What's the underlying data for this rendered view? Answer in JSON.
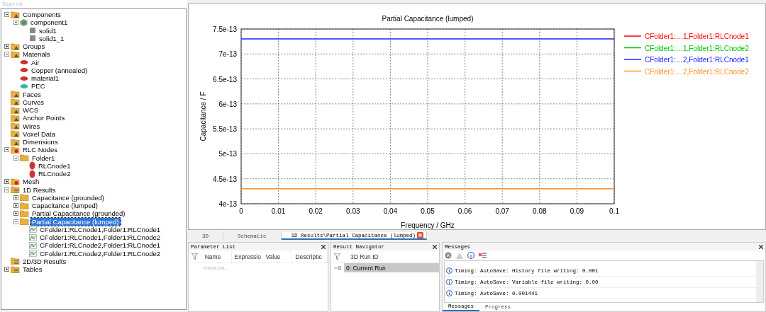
{
  "search": {
    "placeholder": "Search"
  },
  "tree": [
    {
      "label": "Components",
      "kind": "folder",
      "expanded": true,
      "selected": false,
      "children": [
        {
          "label": "component1",
          "kind": "component",
          "expanded": true,
          "selected": false,
          "children": [
            {
              "label": "solid1",
              "kind": "solid",
              "selected": false
            },
            {
              "label": "solid1_1",
              "kind": "solid",
              "selected": false
            }
          ]
        }
      ]
    },
    {
      "label": "Groups",
      "kind": "folder",
      "expanded": false,
      "selected": false
    },
    {
      "label": "Materials",
      "kind": "folder",
      "expanded": true,
      "selected": false,
      "children": [
        {
          "label": "Air",
          "kind": "material",
          "color": "#d03030",
          "selected": false
        },
        {
          "label": "Copper (annealed)",
          "kind": "material",
          "color": "#d03030",
          "selected": false
        },
        {
          "label": "material1",
          "kind": "material",
          "color": "#d03030",
          "selected": false
        },
        {
          "label": "PEC",
          "kind": "material",
          "color": "#30b8b0",
          "selected": false
        }
      ]
    },
    {
      "label": "Faces",
      "kind": "folder",
      "selected": false
    },
    {
      "label": "Curves",
      "kind": "folder",
      "selected": false
    },
    {
      "label": "WCS",
      "kind": "folder",
      "selected": false
    },
    {
      "label": "Anchor Points",
      "kind": "folder",
      "selected": false
    },
    {
      "label": "Wires",
      "kind": "folder",
      "selected": false
    },
    {
      "label": "Voxel Data",
      "kind": "folder",
      "selected": false
    },
    {
      "label": "Dimensions",
      "kind": "folder",
      "selected": false
    },
    {
      "label": "RLC Nodes",
      "kind": "gearfolder",
      "expanded": true,
      "selected": false,
      "children": [
        {
          "label": "Folder1",
          "kind": "plainfolder",
          "expanded": true,
          "selected": false,
          "children": [
            {
              "label": "RLCnode1",
              "kind": "node",
              "selected": false
            },
            {
              "label": "RLCnode2",
              "kind": "node",
              "selected": false
            }
          ]
        }
      ]
    },
    {
      "label": "Mesh",
      "kind": "gearfolder",
      "expanded": false,
      "selected": false
    },
    {
      "label": "1D Results",
      "kind": "resultfolder",
      "expanded": true,
      "selected": false,
      "children": [
        {
          "label": "Capacitance (grounded)",
          "kind": "plainfolder",
          "expanded": false,
          "selected": false
        },
        {
          "label": "Capacitance (lumped)",
          "kind": "plainfolder",
          "expanded": false,
          "selected": false
        },
        {
          "label": "Partial Capacitance (grounded)",
          "kind": "plainfolder",
          "expanded": false,
          "selected": false
        },
        {
          "label": "Partial Capacitance (lumped)",
          "kind": "plainfolder",
          "expanded": true,
          "selected": true,
          "children": [
            {
              "label": "CFolder1:RLCnode1,Folder1:RLCnode1",
              "kind": "curve",
              "selected": false
            },
            {
              "label": "CFolder1:RLCnode1,Folder1:RLCnode2",
              "kind": "curve",
              "selected": false
            },
            {
              "label": "CFolder1:RLCnode2,Folder1:RLCnode1",
              "kind": "curve",
              "selected": false
            },
            {
              "label": "CFolder1:RLCnode2,Folder1:RLCnode2",
              "kind": "curve",
              "selected": false
            }
          ]
        }
      ]
    },
    {
      "label": "2D/3D Results",
      "kind": "resultfolder",
      "selected": false
    },
    {
      "label": "Tables",
      "kind": "resultfolder",
      "expanded": false,
      "selected": false
    }
  ],
  "chart": {
    "chart_data": {
      "type": "line",
      "title": "Partial Capacitance (lumped)",
      "xlabel": "Frequency / GHz",
      "ylabel": "Capacitance / F",
      "x": [
        0,
        0.1
      ],
      "grid": true,
      "legend": true,
      "xlim": [
        0,
        0.1
      ],
      "ylim": [
        4e-13,
        7.5e-13
      ],
      "xticks": [
        0,
        0.01,
        0.02,
        0.03,
        0.04,
        0.05,
        0.06,
        0.07,
        0.08,
        0.09,
        0.1
      ],
      "yticks": [
        {
          "value": 4e-13,
          "label": "4e-13"
        },
        {
          "value": 4.5e-13,
          "label": "4.5e-13"
        },
        {
          "value": 5e-13,
          "label": "5e-13"
        },
        {
          "value": 5.5e-13,
          "label": "5.5e-13"
        },
        {
          "value": 6e-13,
          "label": "6e-13"
        },
        {
          "value": 6.5e-13,
          "label": "6.5e-13"
        },
        {
          "value": 7e-13,
          "label": "7e-13"
        },
        {
          "value": 7.5e-13,
          "label": "7.5e-13"
        }
      ],
      "series": [
        {
          "name": "CFolder1:…1,Folder1:RLCnode1",
          "color": "#ff0000",
          "values": [
            null,
            null
          ]
        },
        {
          "name": "CFolder1:…1,Folder1:RLCnode2",
          "color": "#00c000",
          "values": [
            null,
            null
          ]
        },
        {
          "name": "CFolder1:…2,Folder1:RLCnode1",
          "color": "#2020ff",
          "values": [
            7.3e-13,
            7.3e-13
          ]
        },
        {
          "name": "CFolder1:…2,Folder1:RLCnode2",
          "color": "#ff9020",
          "values": [
            4.3e-13,
            4.3e-13
          ]
        }
      ]
    }
  },
  "view_tabs": [
    {
      "label": "3D",
      "selected": false
    },
    {
      "label": "Schematic",
      "selected": false
    },
    {
      "label": "1D Results\\Partial Capacitance (lumped)",
      "selected": true
    }
  ],
  "parameter_list": {
    "title": "Parameter List",
    "columns": [
      "Name",
      "Expressio",
      "Value",
      "Descriptic"
    ],
    "placeholder": "<new pa..."
  },
  "result_navigator": {
    "title": "Result Navigator",
    "column": "3D Run ID",
    "rows": [
      {
        "label": "0: Current Run",
        "selected": true
      }
    ]
  },
  "messages": {
    "title": "Messages",
    "lines": [
      "Timing: AutoSave: History file writing: 0.001",
      "Timing: AutoSave: Variable file writing: 0.00",
      "Timing: AutoSave: 0.001441"
    ],
    "tabs": [
      {
        "label": "Messages",
        "selected": true
      },
      {
        "label": "Progress",
        "selected": false
      }
    ]
  }
}
